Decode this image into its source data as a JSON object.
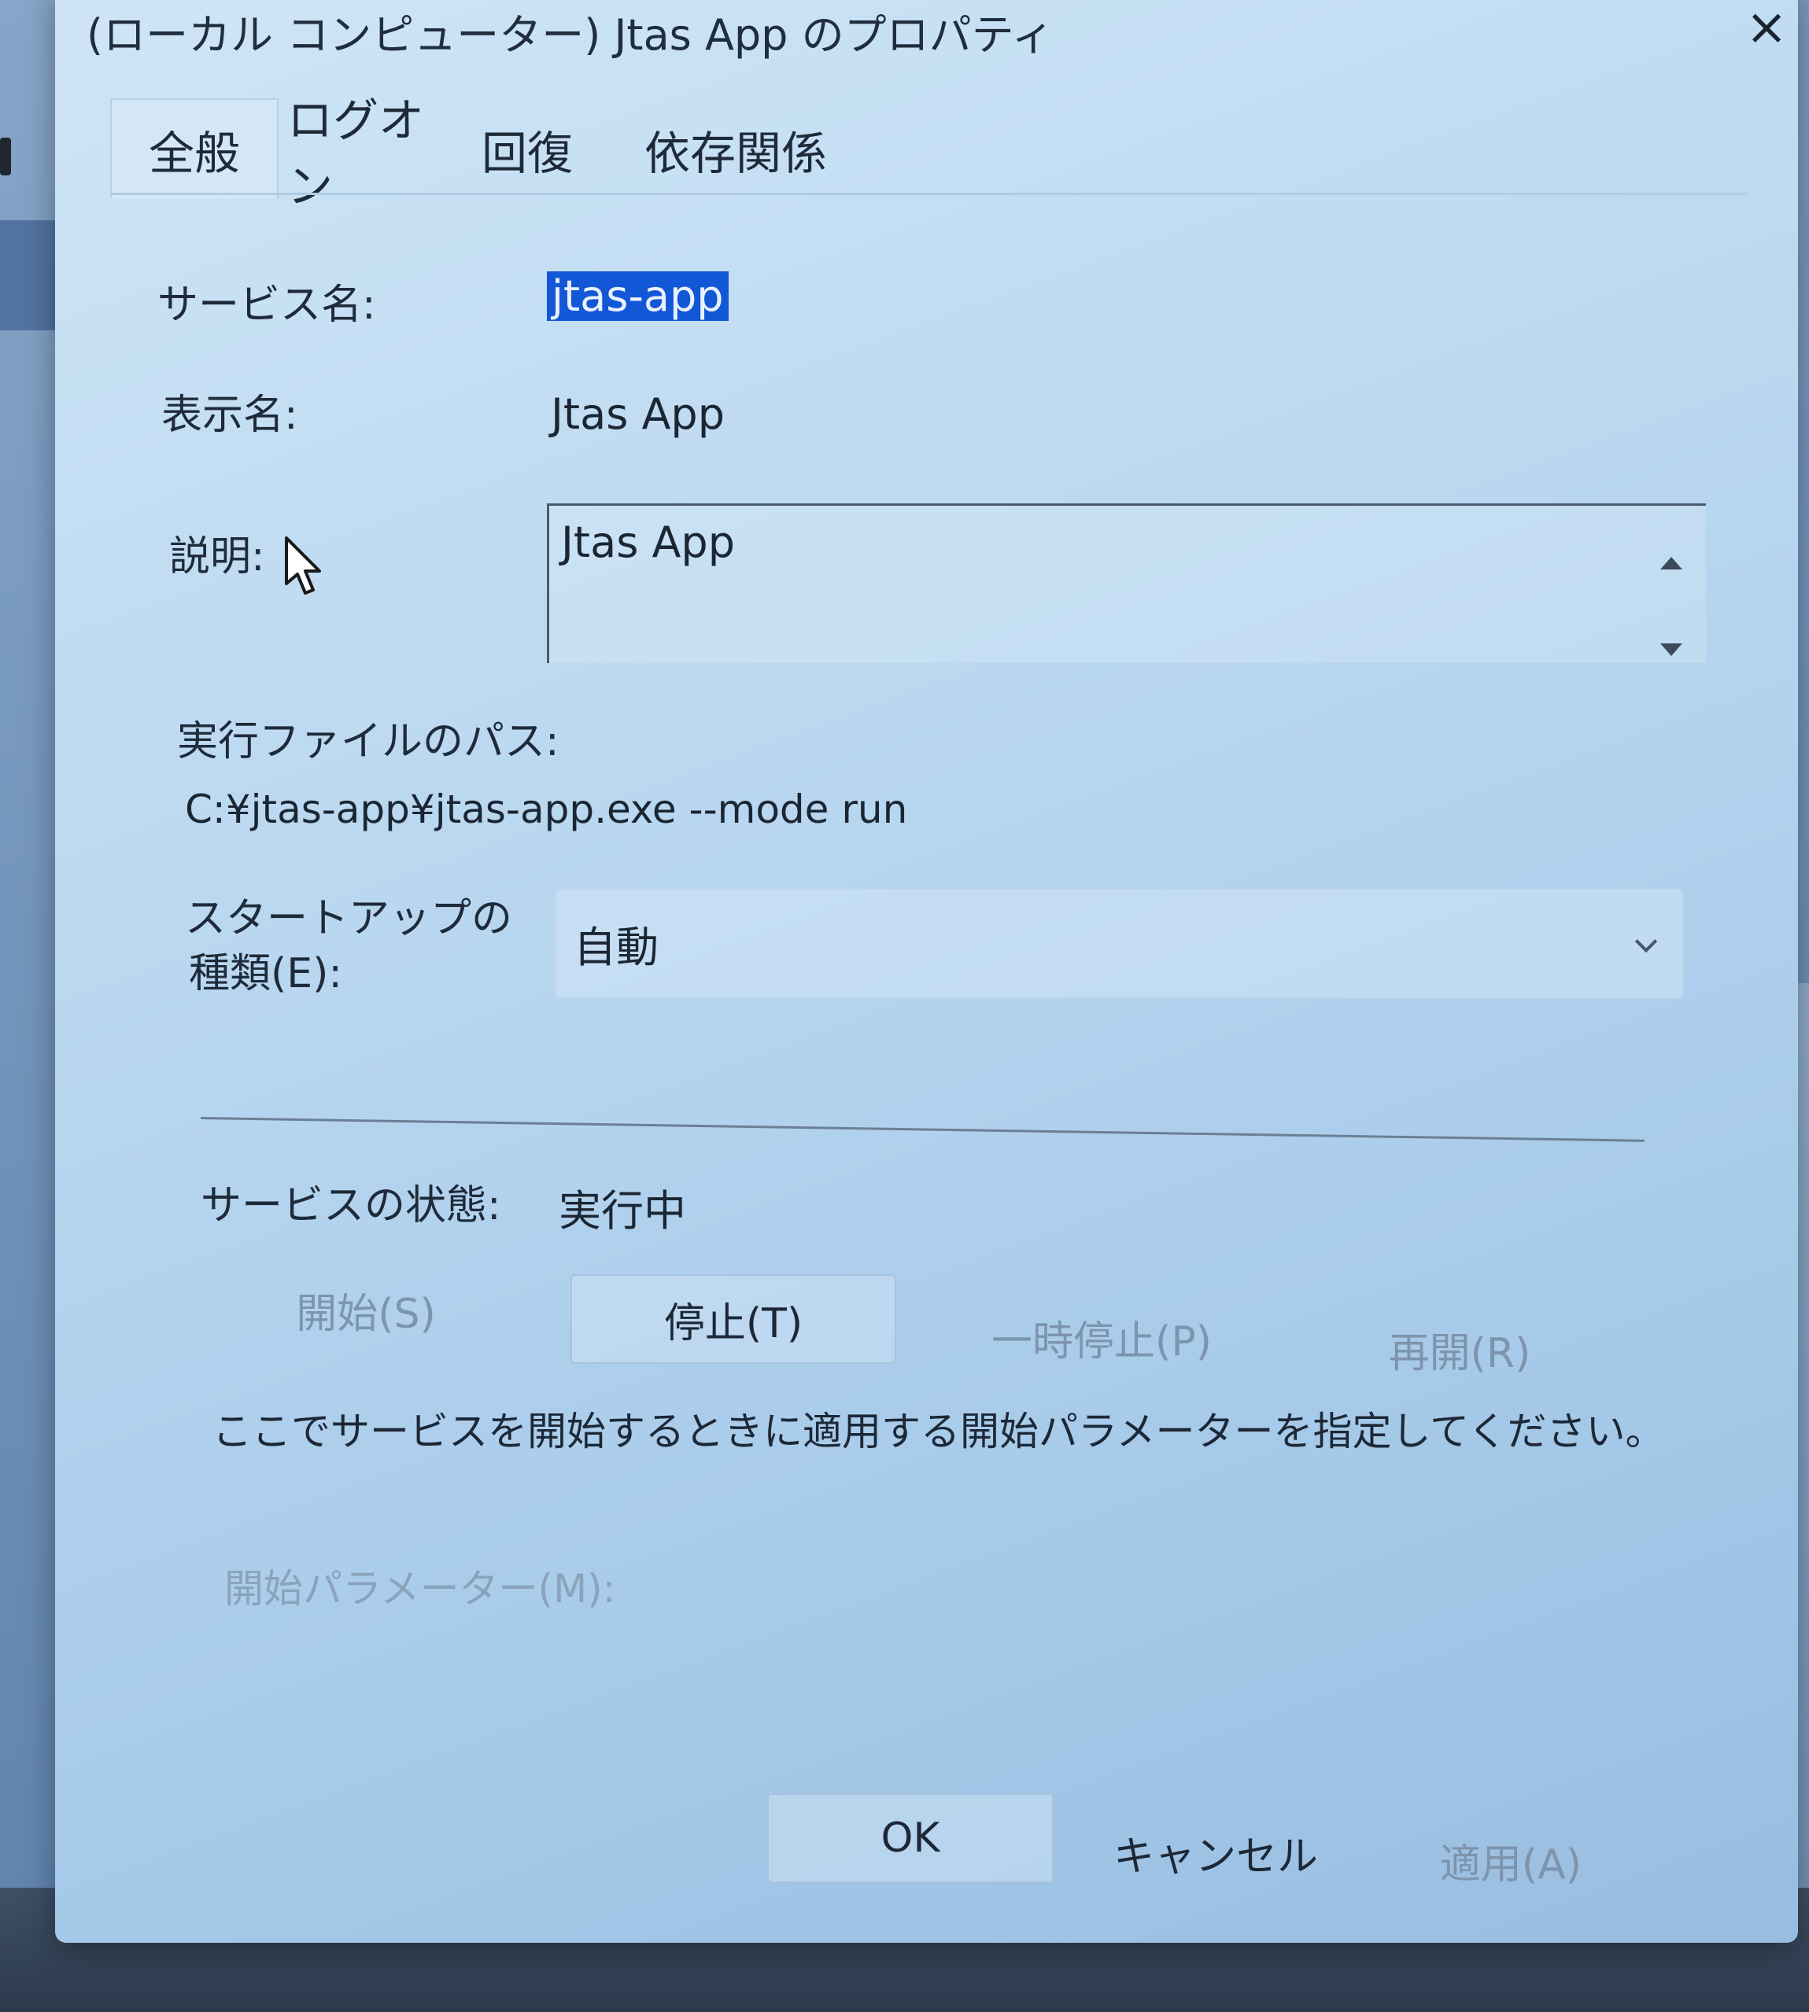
{
  "window": {
    "title": "(ローカル コンピューター) Jtas App のプロパティ",
    "close_icon": "×"
  },
  "tabs": [
    {
      "label": "全般",
      "active": true
    },
    {
      "label": "ログオン",
      "active": false
    },
    {
      "label": "回復",
      "active": false
    },
    {
      "label": "依存関係",
      "active": false
    }
  ],
  "general": {
    "service_name_label": "サービス名:",
    "service_name_value": "jtas-app",
    "display_name_label": "表示名:",
    "display_name_value": "Jtas App",
    "description_label": "説明:",
    "description_value": "Jtas App",
    "exe_path_label": "実行ファイルのパス:",
    "exe_path_value": "C:¥jtas-app¥jtas-app.exe --mode run",
    "startup_label_line1": "スタートアップの",
    "startup_label_line2": "種類(E):",
    "startup_value": "自動",
    "status_label": "サービスの状態:",
    "status_value": "実行中"
  },
  "service_buttons": {
    "start": "開始(S)",
    "stop": "停止(T)",
    "pause": "一時停止(P)",
    "resume": "再開(R)"
  },
  "hint": "ここでサービスを開始するときに適用する開始パラメーターを指定してください。",
  "start_params_label": "開始パラメーター(M):",
  "footer_buttons": {
    "ok": "OK",
    "cancel": "キャンセル",
    "apply": "適用(A)"
  },
  "colors": {
    "selection": "#1257d6",
    "disabled_text": "#7d94ad"
  }
}
